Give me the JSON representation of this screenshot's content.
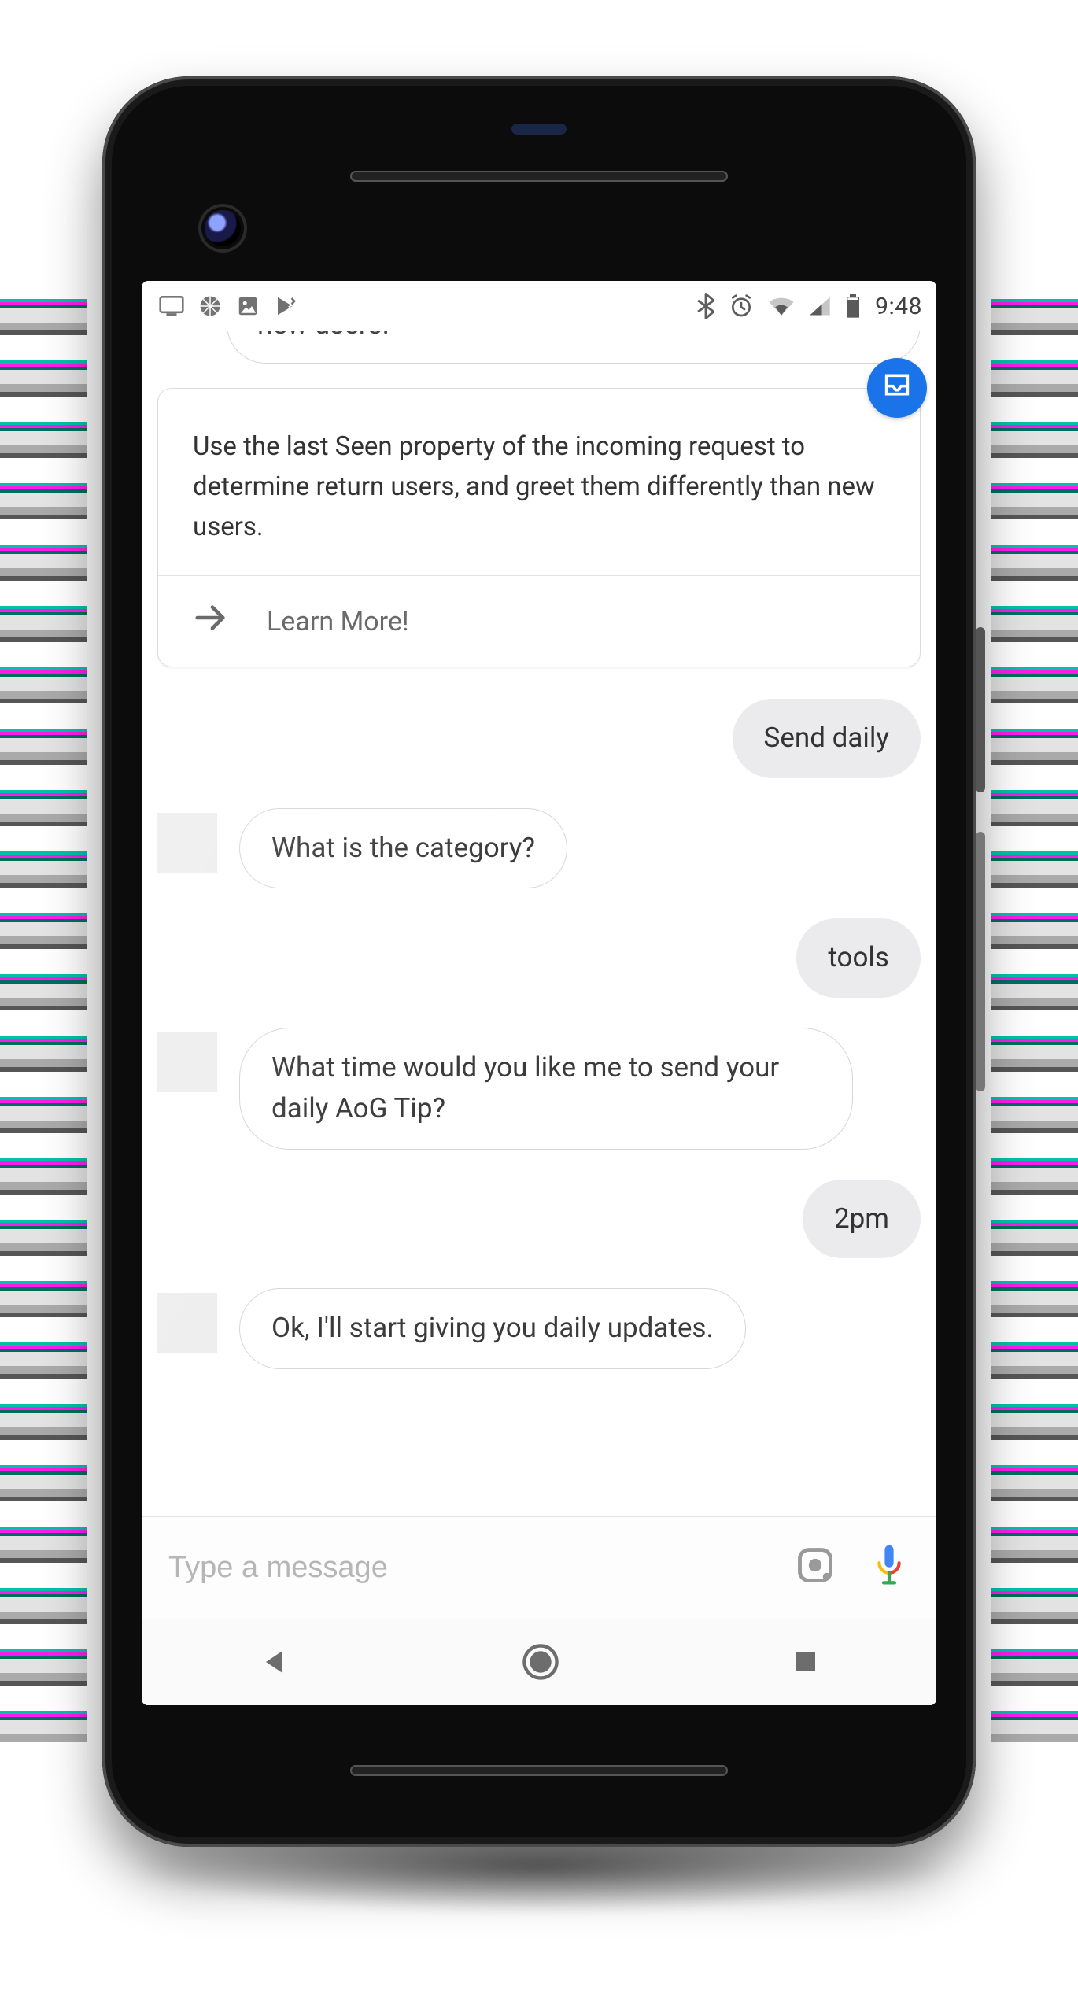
{
  "statusbar": {
    "time": "9:48",
    "left_icons": [
      "cast-icon",
      "basketball-icon",
      "image-icon",
      "play-icon"
    ],
    "right_icons": [
      "bluetooth-icon",
      "alarm-icon",
      "wifi-icon",
      "cell-icon",
      "battery-icon"
    ]
  },
  "cutoff_text": "new users.",
  "card": {
    "body": "Use the last Seen property of the incoming request to determine return users, and greet them differently than new users.",
    "action_label": "Learn More!",
    "badge_icon": "inbox-icon"
  },
  "messages": [
    {
      "id": "m1",
      "role": "user",
      "text": "Send daily"
    },
    {
      "id": "m2",
      "role": "assistant",
      "text": "What is the category?"
    },
    {
      "id": "m3",
      "role": "user",
      "text": "tools"
    },
    {
      "id": "m4",
      "role": "assistant",
      "text": "What time would you like me to send your daily AoG Tip?"
    },
    {
      "id": "m5",
      "role": "user",
      "text": "2pm"
    },
    {
      "id": "m6",
      "role": "assistant",
      "text": "Ok, I'll start giving you daily updates."
    }
  ],
  "composer": {
    "placeholder": "Type a message"
  },
  "colors": {
    "accent_blue": "#1a73e8",
    "bubble_user_bg": "#ebebed",
    "icon_gray": "#6d6d6d"
  }
}
